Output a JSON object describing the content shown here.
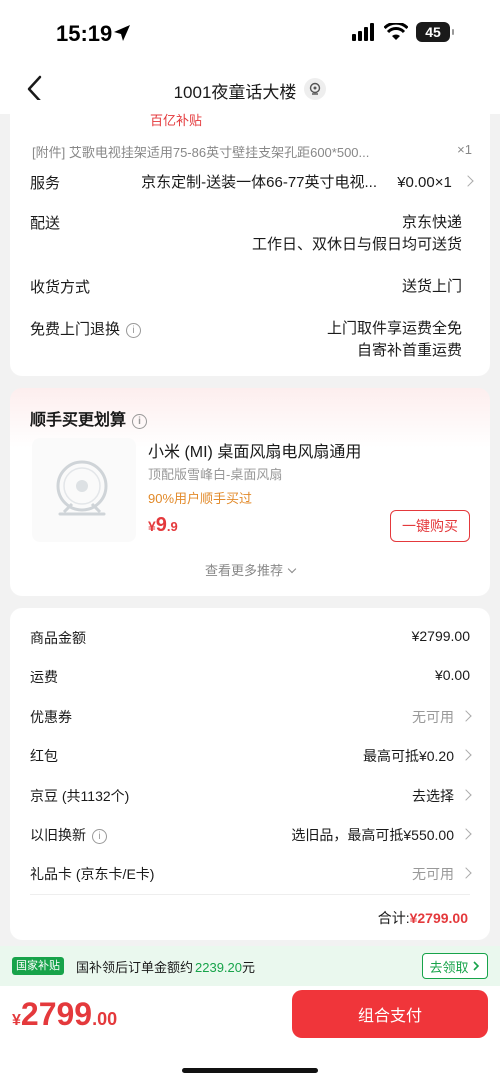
{
  "status_bar": {
    "time": "15:19",
    "battery": "45"
  },
  "nav": {
    "title": "1001夜童话大楼"
  },
  "order": {
    "subsidy_tag": "百亿补贴",
    "attachment": {
      "text": "[附件] 艾歌电视挂架适用75-86英寸壁挂支架孔距600*500...",
      "qty": "×1"
    },
    "service": {
      "label": "服务",
      "value": "京东定制-送装一体66-77英寸电视...",
      "price": "¥0.00×1"
    },
    "delivery": {
      "label": "配送",
      "value_line1": "京东快递",
      "value_line2": "工作日、双休日与假日均可送货"
    },
    "receive": {
      "label": "收货方式",
      "value": "送货上门"
    },
    "return": {
      "label": "免费上门退换",
      "value_line1": "上门取件享运费全免",
      "value_line2": "自寄补首重运费"
    }
  },
  "recommend": {
    "title": "顺手买更划算",
    "product": {
      "name": "小米 (MI) 桌面风扇电风扇通用",
      "spec": "顶配版雪峰白-桌面风扇",
      "percent": "90%用户顺手买过",
      "price_yen": "¥",
      "price_int": "9",
      "price_dec": ".9",
      "buy_label": "一键购买"
    },
    "more_label": "查看更多推荐"
  },
  "summary": {
    "rows": [
      {
        "label": "商品金额",
        "value": "¥2799.00"
      },
      {
        "label": "运费",
        "value": "¥0.00"
      },
      {
        "label": "优惠券",
        "value": "无可用"
      },
      {
        "label": "红包",
        "value": "最高可抵¥0.20"
      },
      {
        "label": "京豆 (共1132个)",
        "value": "去选择"
      },
      {
        "label": "以旧换新",
        "value": "选旧品，最高可抵¥550.00"
      },
      {
        "label": "礼品卡 (京东卡/E卡)",
        "value": "无可用"
      }
    ],
    "total_label": "合计:",
    "total_value": "¥2799.00"
  },
  "subsidy_bar": {
    "badge": "国家补贴",
    "text_prefix": "国补领后订单金额约",
    "amount": "2239.20",
    "unit": "元",
    "claim_label": "去领取"
  },
  "bottom": {
    "yen": "¥",
    "int": "2799",
    "dec": ".00",
    "pay_label": "组合支付"
  },
  "colors": {
    "accent_red": "#e4393c",
    "green": "#17a34a",
    "orange": "#e28a2a"
  }
}
